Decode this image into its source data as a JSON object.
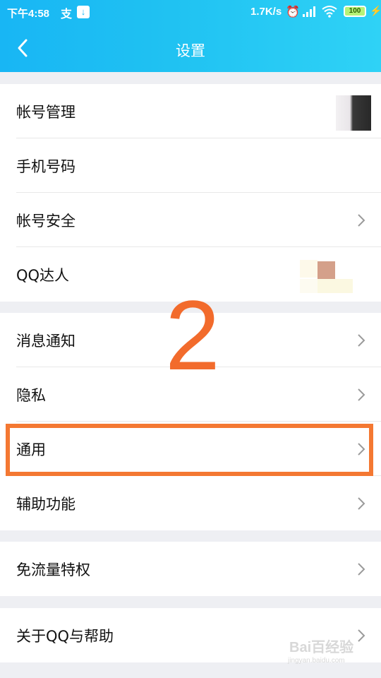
{
  "status_bar": {
    "time": "下午4:58",
    "left_icon_1": "支",
    "left_icon_2": "↓",
    "speed": "1.7K/s",
    "alarm_icon": "alarm-icon",
    "wifi_icon": "wifi-icon",
    "battery": "100",
    "charging_icon": "⚡"
  },
  "nav": {
    "title": "设置",
    "back_icon": "chevron-left-icon"
  },
  "groups": [
    {
      "items": [
        {
          "label": "帐号管理",
          "chevron": false
        },
        {
          "label": "手机号码",
          "chevron": false
        },
        {
          "label": "帐号安全",
          "chevron": true
        },
        {
          "label": "QQ达人",
          "chevron": false
        }
      ]
    },
    {
      "items": [
        {
          "label": "消息通知",
          "chevron": true
        },
        {
          "label": "隐私",
          "chevron": true
        },
        {
          "label": "通用",
          "chevron": true
        },
        {
          "label": "辅助功能",
          "chevron": true
        }
      ]
    },
    {
      "items": [
        {
          "label": "免流量特权",
          "chevron": true
        }
      ]
    },
    {
      "items": [
        {
          "label": "关于QQ与帮助",
          "chevron": true
        }
      ]
    }
  ],
  "annotation": {
    "number": "2",
    "highlight_color": "#f47832"
  },
  "colors": {
    "header_accent": "#1bb8f4",
    "background": "#eeeff3"
  },
  "watermark": {
    "text": "Bai百经验",
    "sub": "jingyan.baidu.com"
  }
}
